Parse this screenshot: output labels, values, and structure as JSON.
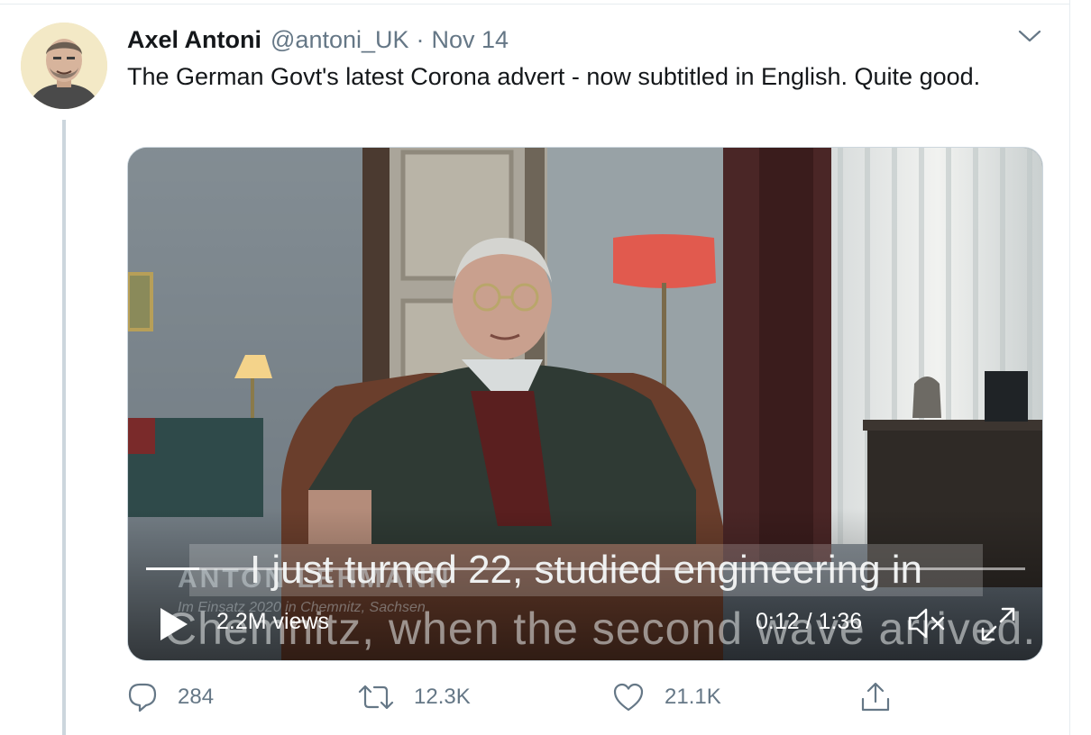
{
  "tweet": {
    "author_name": "Axel Antoni",
    "handle": "@antoni_UK",
    "separator": "·",
    "date": "Nov 14",
    "text": "The German Govt's latest Corona advert - now subtitled in English. Quite good."
  },
  "video": {
    "subtitle_line1": "I just turned 22, studied engineering in",
    "subtitle_line2": "Chemnitz, when the second wave arrived.",
    "lower_third_name": "ANTON LEHMANN",
    "lower_third_caption": "Im Einsatz 2020 in Chemnitz, Sachsen",
    "views": "2.2M views",
    "time": "0:12 / 1:36",
    "progress_fraction": 0.06
  },
  "actions": {
    "reply_count": "284",
    "retweet_count": "12.3K",
    "like_count": "21.1K"
  },
  "icons": [
    "chevron-down-icon",
    "play-icon",
    "mute-icon",
    "fullscreen-icon",
    "reply-icon",
    "retweet-icon",
    "like-icon",
    "share-icon"
  ],
  "colors": {
    "text_primary": "#14171a",
    "text_secondary": "#657786",
    "border": "#ccd6dd"
  }
}
